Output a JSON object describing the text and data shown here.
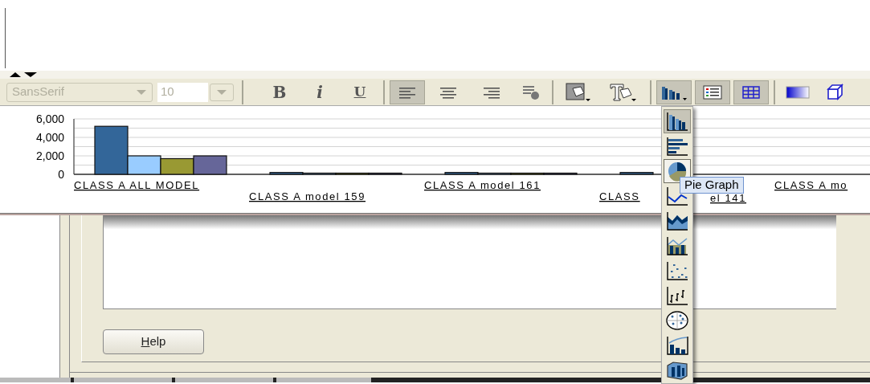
{
  "toolbar": {
    "font_family": {
      "value": "SansSerif",
      "disabled": true
    },
    "font_size": {
      "value": "10",
      "disabled": true
    },
    "groups": [
      [
        {
          "kind": "bold",
          "label": "B",
          "selected": false
        },
        {
          "kind": "italic",
          "label": "i",
          "selected": false
        },
        {
          "kind": "underline",
          "label": "U",
          "selected": false
        }
      ],
      [
        {
          "kind": "align_left",
          "selected": true
        },
        {
          "kind": "align_center",
          "selected": false
        },
        {
          "kind": "align_right",
          "selected": false
        },
        {
          "kind": "format",
          "selected": false
        }
      ],
      [
        {
          "kind": "fill_color",
          "selected": false
        },
        {
          "kind": "font_color",
          "selected": false
        }
      ],
      [
        {
          "kind": "graph_type",
          "selected": true
        },
        {
          "kind": "legend",
          "selected": true
        },
        {
          "kind": "gridlines",
          "selected": true
        }
      ],
      [
        {
          "kind": "gradient",
          "selected": false
        },
        {
          "kind": "three_d",
          "selected": false
        }
      ]
    ]
  },
  "chart": {
    "covered_label_tail": "el 141",
    "chart_data": {
      "type": "bar",
      "categories": [
        "CLASS A ALL MODEL",
        "CLASS A model 159",
        "CLASS A model 161",
        "CLASS",
        "CLASS A mo"
      ],
      "ylim": [
        0,
        6000
      ],
      "yticks": [
        {
          "value": 0,
          "label": "0"
        },
        {
          "value": 2000,
          "label": "2,000"
        },
        {
          "value": 4000,
          "label": "4,000"
        },
        {
          "value": 6000,
          "label": "6,000"
        }
      ],
      "series": [
        {
          "color": "#336699",
          "values": [
            5200,
            200,
            200,
            200,
            null
          ]
        },
        {
          "color": "#99ccff",
          "values": [
            2000,
            100,
            100,
            null,
            null
          ]
        },
        {
          "color": "#999933",
          "values": [
            1700,
            100,
            100,
            null,
            null
          ]
        },
        {
          "color": "#666699",
          "values": [
            2000,
            100,
            100,
            null,
            null
          ]
        }
      ]
    }
  },
  "graph_type_menu": {
    "items": [
      {
        "kind": "bar",
        "selected": true,
        "hovered": false
      },
      {
        "kind": "horizontal_bar",
        "selected": false,
        "hovered": false
      },
      {
        "kind": "pie",
        "selected": false,
        "hovered": true
      },
      {
        "kind": "line",
        "selected": false,
        "hovered": false
      },
      {
        "kind": "area",
        "selected": false,
        "hovered": false
      },
      {
        "kind": "combination",
        "selected": false,
        "hovered": false
      },
      {
        "kind": "scatter",
        "selected": false,
        "hovered": false
      },
      {
        "kind": "stock",
        "selected": false,
        "hovered": false
      },
      {
        "kind": "radar",
        "selected": false,
        "hovered": false
      },
      {
        "kind": "pareto",
        "selected": false,
        "hovered": false
      },
      {
        "kind": "three_d",
        "selected": false,
        "hovered": false
      }
    ],
    "tooltip": "Pie Graph"
  },
  "help_button": {
    "mnemonic": "H",
    "rest": "elp"
  }
}
